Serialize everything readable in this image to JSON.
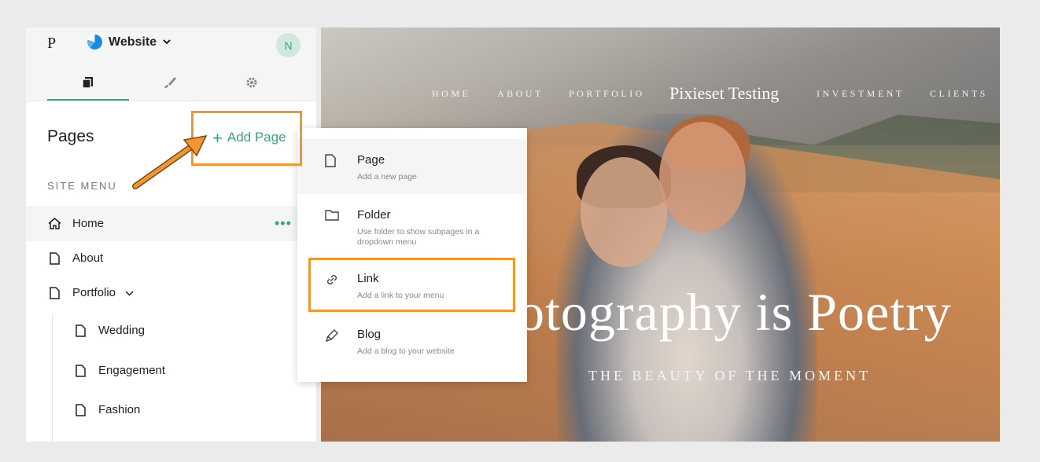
{
  "sidebar": {
    "logo": "P",
    "site_name": "Website",
    "avatar_initial": "N",
    "pages_title": "Pages",
    "add_page_label": "Add Page",
    "site_menu_label": "SITE MENU",
    "items": [
      {
        "label": "Home",
        "icon": "home-icon",
        "selected": true
      },
      {
        "label": "About",
        "icon": "page-icon"
      },
      {
        "label": "Portfolio",
        "icon": "page-icon",
        "expandable": true
      },
      {
        "label": "Wedding",
        "icon": "page-icon",
        "indent": true
      },
      {
        "label": "Engagement",
        "icon": "page-icon",
        "indent": true
      },
      {
        "label": "Fashion",
        "icon": "page-icon",
        "indent": true
      }
    ]
  },
  "dropdown": {
    "items": [
      {
        "label": "Page",
        "desc": "Add a new page",
        "icon": "page-icon"
      },
      {
        "label": "Folder",
        "desc": "Use folder to show subpages in a dropdown menu",
        "icon": "folder-icon"
      },
      {
        "label": "Link",
        "desc": "Add a link to your menu",
        "icon": "link-icon"
      },
      {
        "label": "Blog",
        "desc": "Add a blog to your website",
        "icon": "pen-icon"
      }
    ]
  },
  "hero": {
    "nav": [
      "HOME",
      "ABOUT",
      "PORTFOLIO",
      "INVESTMENT",
      "CLIENTS"
    ],
    "brand": "Pixieset Testing",
    "headline": "otography is Poetry",
    "subheadline": "THE BEAUTY OF THE MOMENT"
  },
  "colors": {
    "accent": "#3aa57a",
    "annotation": "#f0972f"
  }
}
